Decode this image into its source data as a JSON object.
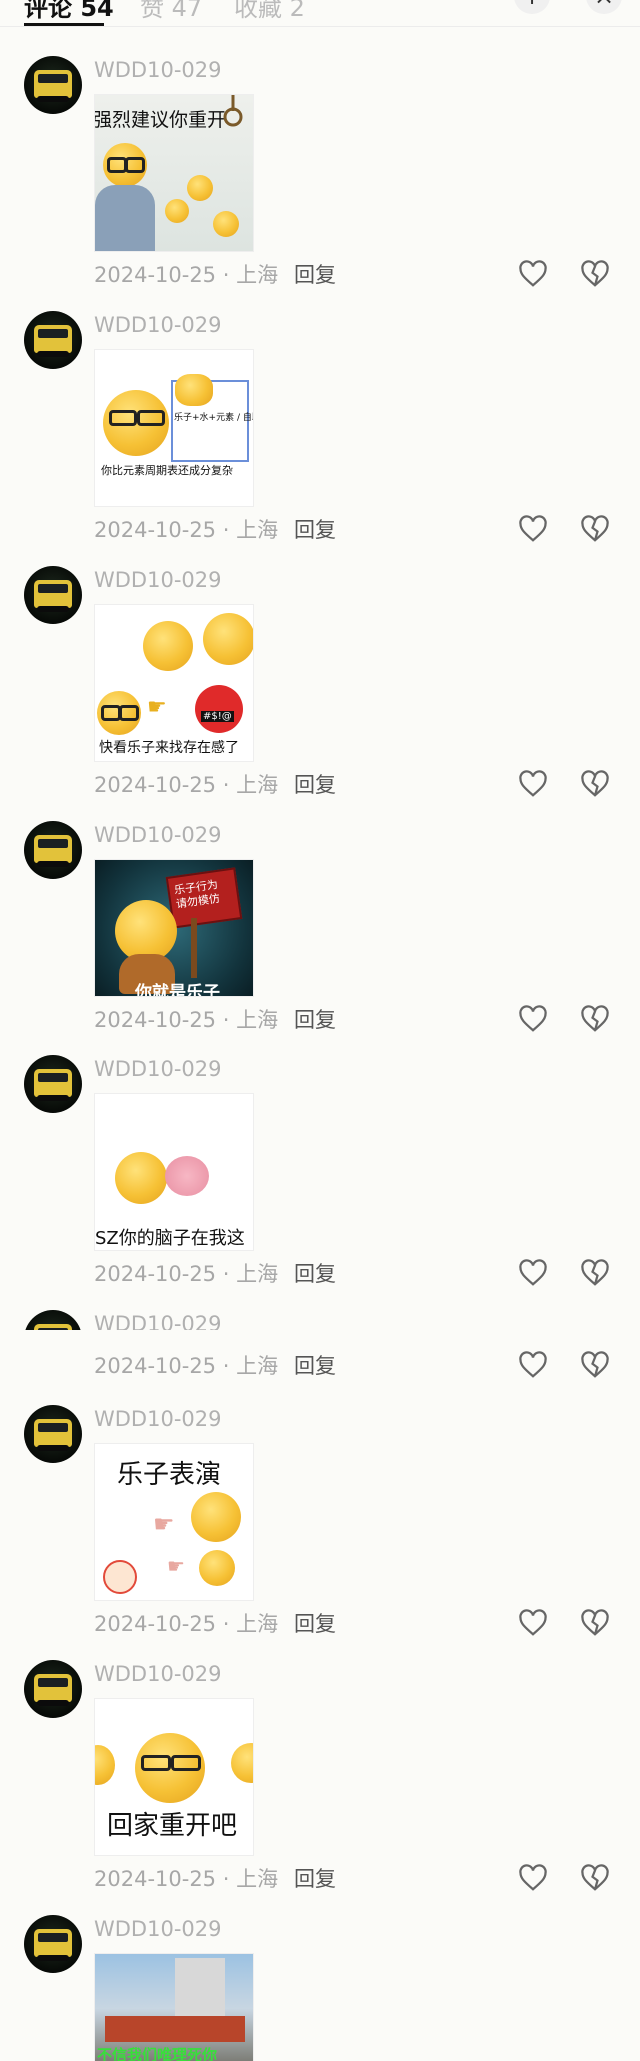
{
  "tabs": [
    {
      "label": "评论 54",
      "active": true
    },
    {
      "label": "赞 47",
      "active": false
    },
    {
      "label": "收藏 2",
      "active": false
    }
  ],
  "top_actions": [
    {
      "icon": "add-icon",
      "glyph": "+"
    },
    {
      "icon": "close-icon",
      "glyph": "×"
    }
  ],
  "comments": [
    {
      "username": "WDD10-029",
      "date": "2024-10-25",
      "location": "上海",
      "reply": "回复",
      "sticker_text": "强烈建议你重开"
    },
    {
      "username": "WDD10-029",
      "date": "2024-10-25",
      "location": "上海",
      "reply": "回复",
      "sticker_text": "你比元素周期表还成分复杂",
      "sticker_subtext": "乐子+水+元素 / 自助表"
    },
    {
      "username": "WDD10-029",
      "date": "2024-10-25",
      "location": "上海",
      "reply": "回复",
      "sticker_text": "快看乐子来找存在感了",
      "sticker_subtext": "#$!@"
    },
    {
      "username": "WDD10-029",
      "date": "2024-10-25",
      "location": "上海",
      "reply": "回复",
      "sticker_text": "你就是乐子",
      "sticker_subtext": "乐子行为 请勿模仿"
    },
    {
      "username": "WDD10-029",
      "date": "2024-10-25",
      "location": "上海",
      "reply": "回复",
      "sticker_text": "SZ你的脑子在我这"
    },
    {
      "username": "WDD10-029",
      "date": "2024-10-25",
      "location": "上海",
      "reply": "回复"
    },
    {
      "username": "WDD10-029",
      "date": "2024-10-25",
      "location": "上海",
      "reply": "回复",
      "sticker_text": "乐子表演"
    },
    {
      "username": "WDD10-029",
      "date": "2024-10-25",
      "location": "上海",
      "reply": "回复",
      "sticker_text": "回家重开吧"
    },
    {
      "username": "WDD10-029",
      "sticker_text": "不信我们唯理死你"
    }
  ]
}
